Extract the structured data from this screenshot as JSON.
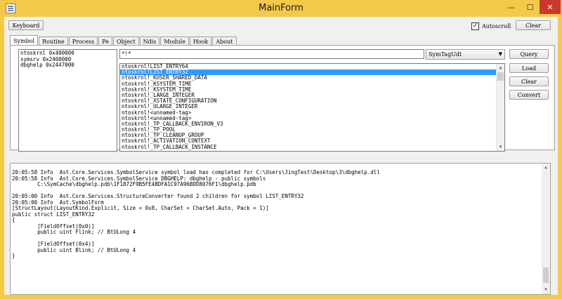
{
  "window": {
    "title": "MainForm"
  },
  "controls": {
    "keyboard_button": "Keyboard",
    "autoscroll_label": "Autoscroll",
    "autoscroll_checked": true,
    "clear_button": "Clear"
  },
  "tabs": [
    {
      "label": "Symbol",
      "active": true
    },
    {
      "label": "Routine"
    },
    {
      "label": "Process"
    },
    {
      "label": "Pe"
    },
    {
      "label": "Object"
    },
    {
      "label": "Ndis"
    },
    {
      "label": "Module"
    },
    {
      "label": "Hook"
    },
    {
      "label": "About"
    }
  ],
  "symbol_tab": {
    "modules": [
      "ntoskrnl 0x400000",
      "symsrv 0x2400000",
      "dbghelp 0x2447000"
    ],
    "query_value": "*!*",
    "type_select": "SymTagUdt",
    "symbols": [
      "ntoskrnl!LIST_ENTRY64",
      "ntoskrnl!LIST_ENTRY32",
      "ntoskrnl!_KUSER_SHARED_DATA",
      "ntoskrnl!_KSYSTEM_TIME",
      "ntoskrnl!_KSYSTEM_TIME",
      "ntoskrnl!_LARGE_INTEGER",
      "ntoskrnl!_XSTATE_CONFIGURATION",
      "ntoskrnl!_ULARGE_INTEGER",
      "ntoskrnl!<unnamed-tag>",
      "ntoskrnl!<unnamed-tag>",
      "ntoskrnl!_TP_CALLBACK_ENVIRON_V3",
      "ntoskrnl!_TP_POOL",
      "ntoskrnl!_TP_CLEANUP_GROUP",
      "ntoskrnl!_ACTIVATION_CONTEXT",
      "ntoskrnl!_TP_CALLBACK_INSTANCE"
    ],
    "selected_index": 1,
    "buttons": {
      "query": "Query",
      "load": "Load",
      "clear": "Clear",
      "convert": "Convert"
    }
  },
  "log": {
    "lines": [
      "20:05:58 Info  Ast.Core.Services.SymbolService symbol load has completed for C:\\Users\\JingTest\\Desktop\\3\\dbghelp.dll",
      "20:05:58 Info  Ast.Core.Services.SymbolService DBGHELP: dbghelp - public symbols",
      "        C:\\SymCache\\dbghelp.pdb\\1F1872F9B5FE4BDFA1C97A96BDD8076F1\\dbghelp.pdb",
      "",
      "20:05:00 Info  Ast.Core.Services.StructureConverter found 2 children for symbol LIST_ENTRY32",
      "20:05:00 Info  Ast.SymbolForm",
      "[StructLayout(LayoutKind.Explicit, Size = 0x8, CharSet = CharSet.Auto, Pack = 1)]",
      "public struct LIST_ENTRY32",
      "{",
      "        [FieldOffset(0x0)]",
      "        public uint Flink; // BtULong 4",
      "",
      "        [FieldOffset(0x4)]",
      "        public uint Blink; // BtULong 4",
      "}"
    ]
  },
  "icons": {
    "app": "app-window-icon",
    "minimize": "minimize-icon",
    "maximize": "maximize-icon",
    "close": "close-icon",
    "dropdown": "chevron-down-icon"
  },
  "colors": {
    "title_bar": "#f3c94a",
    "close_button": "#c8392c",
    "selection": "#3399ff"
  }
}
